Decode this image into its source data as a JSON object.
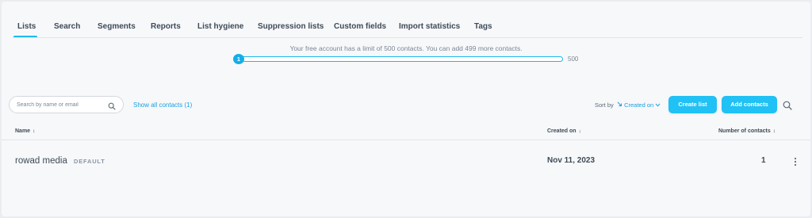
{
  "tabs": [
    {
      "label": "Lists",
      "active": true
    },
    {
      "label": "Search"
    },
    {
      "label": "Segments"
    },
    {
      "label": "Reports"
    },
    {
      "label": "List hygiene"
    },
    {
      "label": "Suppression lists"
    },
    {
      "label": "Custom fields"
    },
    {
      "label": "Import statistics"
    },
    {
      "label": "Tags"
    }
  ],
  "limit": {
    "message": "Your free account has a limit of 500 contacts. You can add 499 more contacts.",
    "current": "1",
    "max": "500",
    "progress_fraction": 0.002
  },
  "toolbar": {
    "search_placeholder": "Search by name or email",
    "show_all_label": "Show all contacts (1)",
    "sort_label": "Sort by",
    "sort_value": "Created on",
    "create_list_label": "Create list",
    "add_contacts_label": "Add contacts"
  },
  "table": {
    "columns": {
      "name": "Name",
      "created": "Created on",
      "count": "Number of contacts"
    },
    "rows": [
      {
        "name": "rowad media",
        "badge": "DEFAULT",
        "created": "Nov 11, 2023",
        "count": "1"
      }
    ]
  },
  "colors": {
    "accent": "#20c1f5",
    "link": "#1a9fe0",
    "text": "#3d4b57"
  },
  "icons": {
    "search": "search-icon",
    "sort_direction": "sort-arrow-icon",
    "sort_dropdown": "chevron-down-icon",
    "row_menu": "kebab-menu-icon"
  }
}
